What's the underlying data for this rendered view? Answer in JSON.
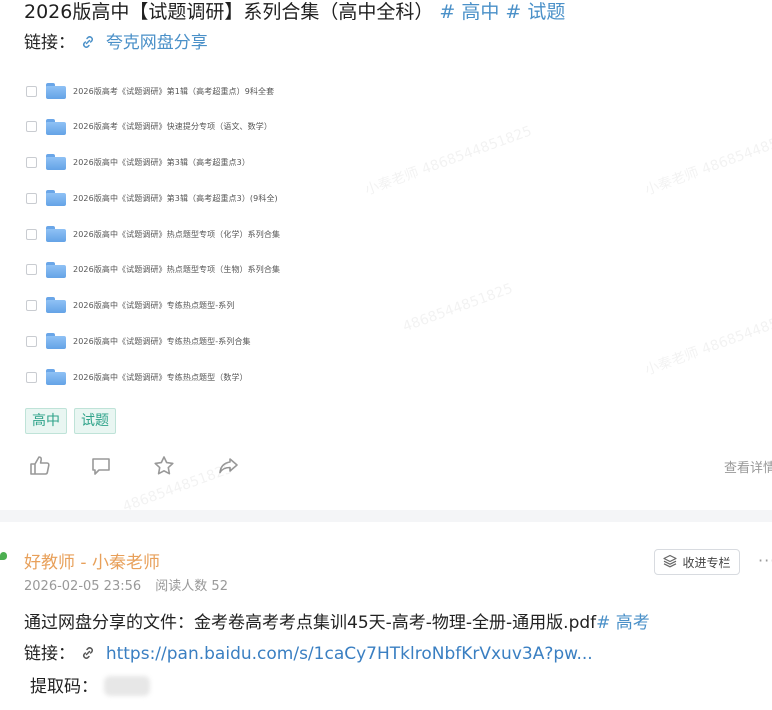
{
  "post1": {
    "title": "2026版高中【试题调研】系列合集（高中全科）",
    "hashtags": [
      "# 高中",
      "# 试题"
    ],
    "link_label": "链接：",
    "link_text": "夸克网盘分享",
    "files": [
      "2026版高考《试题调研》第1辑（高考超重点）9科全套",
      "2026版高考《试题调研》快速提分专项（语文、数学）",
      "2026版高中《试题调研》第3辑（高考超重点3）",
      "2026版高中《试题调研》第3辑（高考超重点3）(9科全)",
      "2026版高中《试题调研》热点题型专项（化学）系列合集",
      "2026版高中《试题调研》热点题型专项（生物）系列合集",
      "2026版高中《试题调研》专练热点题型-系列",
      "2026版高中《试题调研》专练热点题型-系列合集",
      "2026版高中《试题调研》专练热点题型（数学）"
    ],
    "tags": [
      "高中",
      "试题"
    ],
    "actions": [
      "like-icon",
      "comment-icon",
      "star-icon",
      "share-icon"
    ],
    "detail_link": "查看详情"
  },
  "post2": {
    "author": "好教师 - 小秦老师",
    "date": "2026-02-05 23:56",
    "readers": "阅读人数 52",
    "collect_button": "收进专栏",
    "more": "···",
    "text": "通过网盘分享的文件：金考卷高考考点集训45天-高考-物理-全册-通用版.pdf",
    "hashtag": "# 高考",
    "link_label": "链接：",
    "url": "https://pan.baidu.com/s/1caCy7HTklroNbfKrVxuv3A?pw...",
    "code_label": "提取码："
  },
  "watermarks": [
    "小秦老师 4868544851825",
    "小秦老师 4868544851825",
    "4868544851825",
    "4868544851825",
    "小秦老师 4868544851825",
    "4868544851825"
  ],
  "colors": {
    "link": "#4a90c8",
    "tag": "#2fa38a",
    "author": "#e8a05a",
    "folder": "#6aa6e8"
  }
}
